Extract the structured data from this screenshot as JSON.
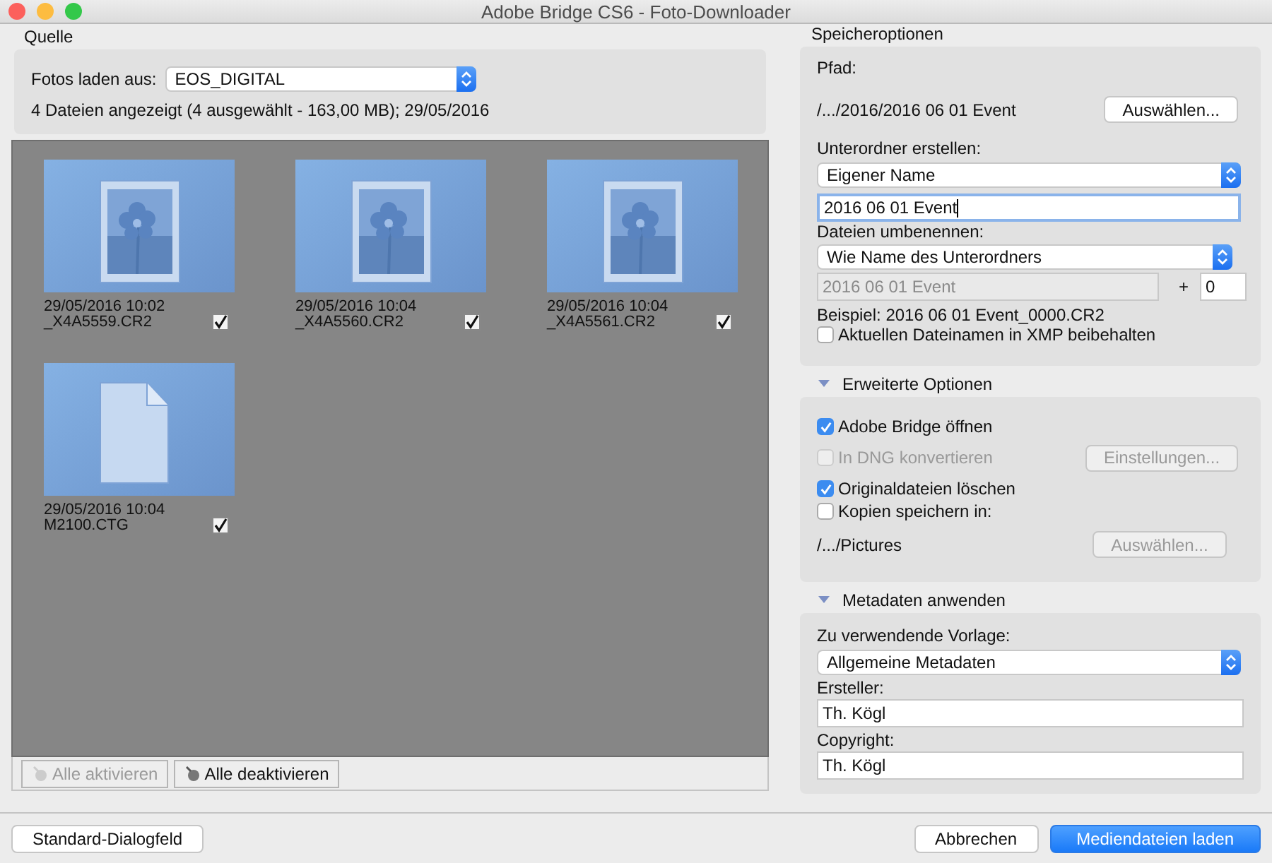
{
  "window": {
    "title": "Adobe Bridge CS6 - Foto-Downloader"
  },
  "source": {
    "title": "Quelle",
    "load_label": "Fotos laden aus:",
    "device": "EOS_DIGITAL",
    "info": "4 Dateien angezeigt (4 ausgewählt - 163,00 MB); 29/05/2016"
  },
  "files": [
    {
      "kind": "photo",
      "date": "29/05/2016 10:02",
      "name": "_X4A5559.CR2",
      "checked": true
    },
    {
      "kind": "photo",
      "date": "29/05/2016 10:04",
      "name": "_X4A5560.CR2",
      "checked": true
    },
    {
      "kind": "photo",
      "date": "29/05/2016 10:04",
      "name": "_X4A5561.CR2",
      "checked": true
    },
    {
      "kind": "document",
      "date": "29/05/2016 10:04",
      "name": "M2100.CTG",
      "checked": true
    }
  ],
  "file_buttons": [
    {
      "label": "Alle aktivieren",
      "disabled": true
    },
    {
      "label": "Alle deaktivieren",
      "disabled": false
    }
  ],
  "save_options": {
    "title": "Speicheroptionen",
    "path_label": "Pfad:",
    "path": "/.../2016/2016 06 01 Event",
    "choose_button": "Auswählen...",
    "subfolder_label": "Unterordner erstellen:",
    "subfolder_mode": "Eigener Name",
    "subfolder_name": "2016 06 01 Event",
    "rename_label": "Dateien umbenennen:",
    "rename_mode": "Wie Name des Unterordners",
    "rename_base": "2016 06 01 Event",
    "plus": "+",
    "counter": "0",
    "example": "Beispiel: 2016 06 01 Event_0000.CR2",
    "keep_name": {
      "label": "Aktuellen Dateinamen in XMP beibehalten",
      "checked": false
    }
  },
  "advanced": {
    "title": "Erweiterte Optionen",
    "expanded": true,
    "options": [
      {
        "label": "Adobe Bridge öffnen",
        "checked": true,
        "disabled": false
      },
      {
        "label": "In DNG konvertieren",
        "checked": false,
        "disabled": true,
        "button": {
          "label": "Einstellungen...",
          "disabled": true
        }
      },
      {
        "label": "Originaldateien löschen",
        "checked": true,
        "disabled": false
      },
      {
        "label": "Kopien speichern in:",
        "checked": false,
        "disabled": false
      }
    ],
    "copy_path": "/.../Pictures",
    "copy_button": {
      "label": "Auswählen...",
      "disabled": true
    }
  },
  "metadata": {
    "title": "Metadaten anwenden",
    "expanded": true,
    "template_label": "Zu verwendende Vorlage:",
    "template": "Allgemeine Metadaten",
    "fields": [
      {
        "label": "Ersteller:",
        "value": "Th. Kögl"
      },
      {
        "label": "Copyright:",
        "value": "Th. Kögl"
      }
    ]
  },
  "footer": {
    "left": [
      {
        "label": "Standard-Dialogfeld",
        "kind": "default"
      }
    ],
    "right": [
      {
        "label": "Abbrechen",
        "kind": "default"
      },
      {
        "label": "Mediendateien laden",
        "kind": "primary"
      }
    ]
  }
}
